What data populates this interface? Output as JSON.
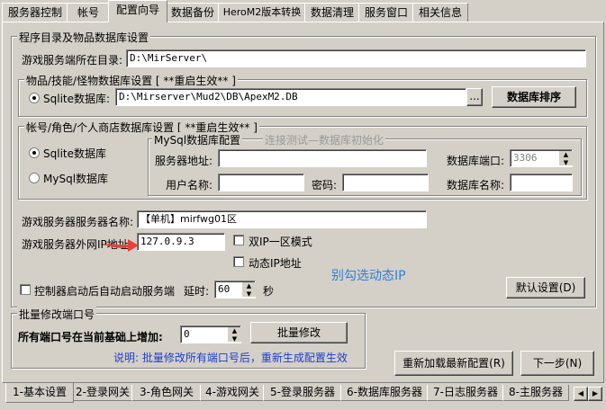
{
  "top_tabs": [
    "服务器控制",
    "帐号",
    "配置向导",
    "数据备份",
    "HeroM2版本转换",
    "数据清理",
    "服务窗口",
    "相关信息"
  ],
  "main_group_title": "程序目录及物品数据库设置",
  "server_dir": {
    "label": "游戏服务端所在目录:",
    "value": "D:\\MirServer\\"
  },
  "item_db": {
    "title": "物品/技能/怪物数据库设置 [ **重启生效** ]",
    "radio_label": "Sqlite数据库:",
    "path": "D:\\Mirserver\\Mud2\\DB\\ApexM2.DB",
    "browse_label": "...",
    "sort_button": "数据库排序"
  },
  "account_db": {
    "title": "帐号/角色/个人商店数据库设置 [ **重启生效** ]",
    "sqlite_label": "Sqlite数据库",
    "mysql_label": "MySql数据库",
    "mysql_config_title": "MySql数据库配置",
    "mysql_config_hint": "连接测试—数据库初始化",
    "server_addr_label": "服务器地址:",
    "port_label": "数据库端口:",
    "port_value": "3306",
    "username_label": "用户名称:",
    "password_label": "密码:",
    "dbname_label": "数据库名称:"
  },
  "server_name": {
    "label": "游戏服务器服务器名称:",
    "value": "【单机】mirfwg01区"
  },
  "external_ip": {
    "label": "游戏服务器外网IP地址:",
    "value": "127.0.9.3"
  },
  "dual_ip_label": "双IP一区模式",
  "dynamic_ip_label": "动态IP地址",
  "annotation": "别勾选动态IP",
  "autostart": {
    "label": "控制器启动后自动启动服务端",
    "delay_label": "延时:",
    "delay_value": "60",
    "unit": "秒"
  },
  "default_button": "默认设置(D)",
  "port_group": {
    "title": "批量修改端口号",
    "label": "所有端口号在当前基础上增加:",
    "value": "0",
    "button": "批量修改",
    "note": "说明: 批量修改所有端口号后，重新生成配置生效"
  },
  "reload_button": "重新加载最新配置(R)",
  "next_button": "下一步(N)",
  "bottom_tabs": [
    "1-基本设置",
    "2-登录网关",
    "3-角色网关",
    "4-游戏网关",
    "5-登录服务器",
    "6-数据库服务器",
    "7-日志服务器",
    "8-主服务器"
  ],
  "colors": {
    "annotation": "#2f7fdc",
    "note": "#1a3fcf",
    "arrow": "#e8403a"
  }
}
